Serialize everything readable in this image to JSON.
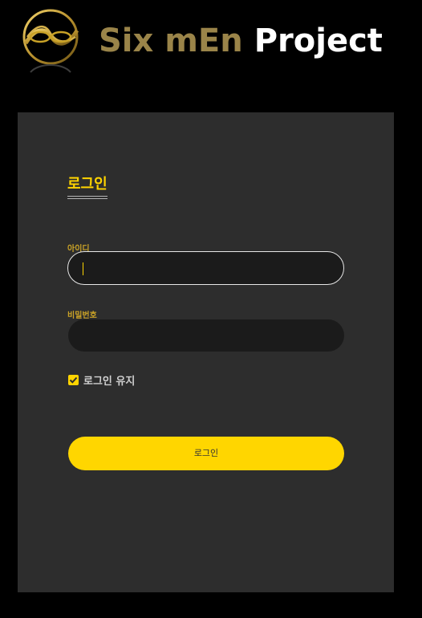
{
  "header": {
    "logo_icon": "six-men-logo-icon",
    "brand_part1": "Six mEn",
    "brand_part2": "Project",
    "brand_part1_color": "#9a8449",
    "brand_part2_color": "#ffffff"
  },
  "login_form": {
    "title": "로그인",
    "id_label": "아이디",
    "id_value": "",
    "password_label": "비밀번호",
    "password_value": "",
    "remember_label": "로그인 유지",
    "remember_checked": true,
    "submit_label": "로그인"
  },
  "colors": {
    "accent": "#ffd400",
    "card_background": "#2d2d2d",
    "page_background": "#000000",
    "input_background": "#1b1b1b"
  }
}
